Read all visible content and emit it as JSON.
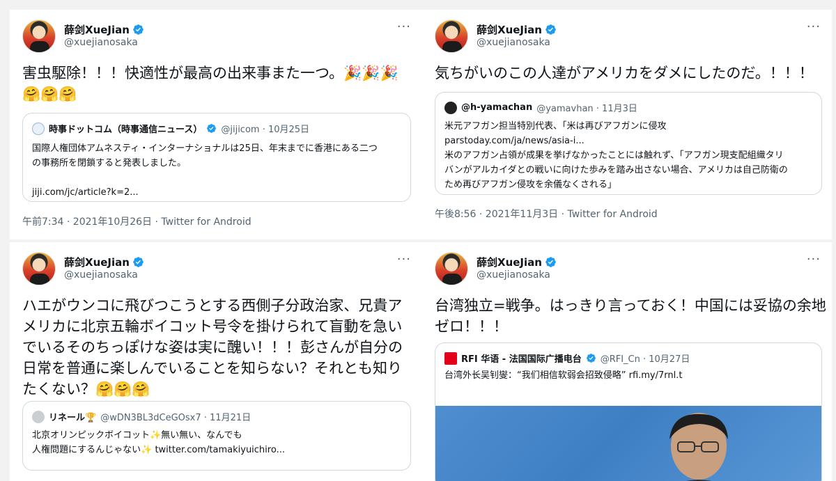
{
  "colors": {
    "accent": "#1d9bf0",
    "muted": "#536471",
    "border": "#cfd9de"
  },
  "tweets": [
    {
      "author": "薛剑XueJian",
      "handle": "@xuejianosaka",
      "more": "···",
      "text_line1": "害虫駆除！！！快適性が最高の出来事また一つ。🎉🎉🎉",
      "text_line2": "🤗🤗🤗",
      "quote": {
        "name": "時事ドットコム（時事通信ニュース）",
        "meta": "@jijicom · 10月25日",
        "line1": "国際人権団体アムネスティ・インターナショナルは25日、年末までに香港にある二つ",
        "line2": "の事務所を閉鎖すると発表しました。",
        "line3": "",
        "line4": "jiji.com/jc/article?k=2..."
      },
      "footer": "午前7:34 · 2021年10月26日 · Twitter for Android"
    },
    {
      "author": "薛剑XueJian",
      "handle": "@xuejianosaka",
      "more": "···",
      "text_line1": "気ちがいのこの人達がアメリカをダメにしたのだ。！！！",
      "quote": {
        "name": "@h-yamachan",
        "meta": "@yamavhan · 11月3日",
        "line1": "米元アフガン担当特別代表、「米は再びアフガンに侵攻",
        "line2": "parstoday.com/ja/news/asia-i...",
        "line3": "米のアフガン占領が成果を挙げなかったことには触れず、「アフガン現支配組織タリ",
        "line4": "バンがアルカイダとの戦いに向けた歩みを踏み出さない場合、アメリカは自己防衛の",
        "line5": "ため再びアフガン侵攻を余儀なくされる」"
      },
      "footer": "午後8:56 · 2021年11月3日 · Twitter for Android"
    },
    {
      "author": "薛剑XueJian",
      "handle": "@xuejianosaka",
      "more": "···",
      "text_line1": "ハエがウンコに飛びつこうとする西側子分政治家、兄貴ア",
      "text_line2": "メリカに北京五輪ボイコット号令を掛けられて盲動を急い",
      "text_line3": "でいるそのちっぽけな姿は実に醜い！！！彭さんが自分の",
      "text_line4": "日常を普通に楽しんでいることを知らない？それとも知り",
      "text_line5": "たくない？🤗🤗🤗",
      "quote": {
        "name": "リネール🏆",
        "meta": "@wDN3BL3dCeGOsx7 · 11月21日",
        "line1": "北京オリンピックボイコット✨無い無い、なんでも",
        "line2": "人権問題にするんじゃない✨ twitter.com/tamakiyuichiro..."
      }
    },
    {
      "author": "薛剑XueJian",
      "handle": "@xuejianosaka",
      "more": "···",
      "text_line1": "台湾独立=戦争。はっきり言っておく！中国には妥協の余地",
      "text_line2": "ゼロ！！！",
      "quote": {
        "name": "RFI 华语 - 法国国际广播电台",
        "meta": "@RFI_Cn · 10月27日",
        "line1": "台湾外长吴钊燮：“我们相信软弱会招致侵略” rfi.my/7rnl.t"
      }
    }
  ]
}
